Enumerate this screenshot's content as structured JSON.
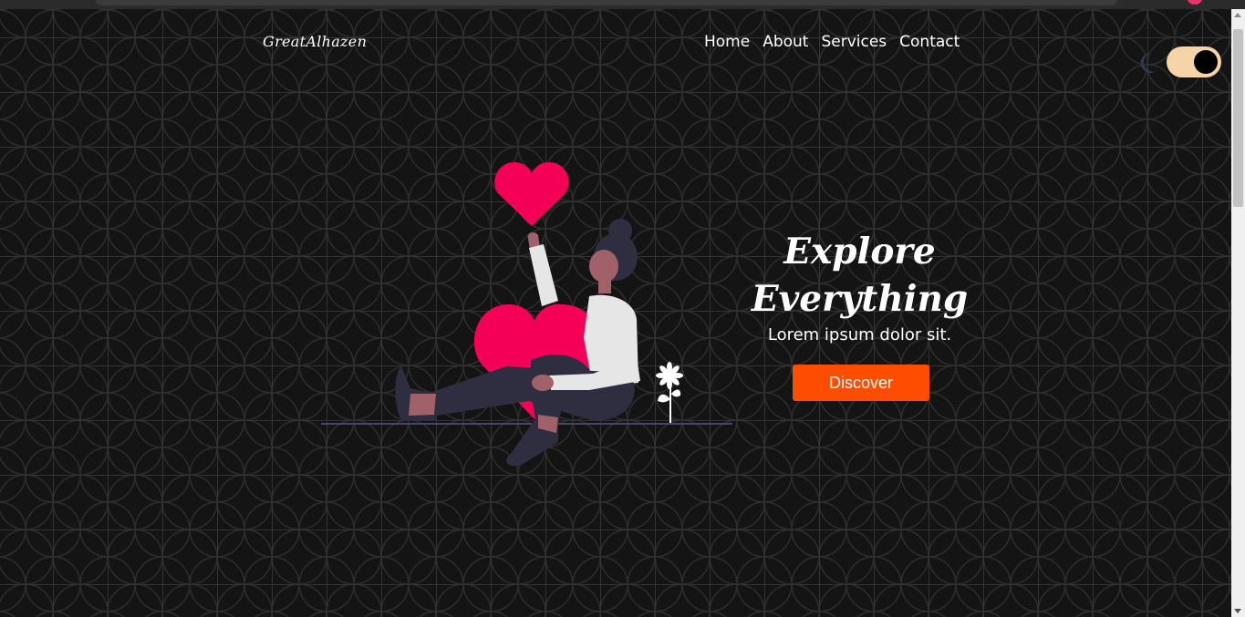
{
  "header": {
    "logo": "GreatAlhazen",
    "nav": [
      "Home",
      "About",
      "Services",
      "Contact"
    ],
    "theme_icon": "moon-icon"
  },
  "hero": {
    "title_line1": "Explore",
    "title_line2": "Everything",
    "subtitle": "Lorem ipsum dolor sit.",
    "cta_label": "Discover"
  },
  "colors": {
    "background": "#141414",
    "accent": "#ff4d00",
    "heart": "#f50057",
    "toggle_track": "#f5d5a8"
  }
}
